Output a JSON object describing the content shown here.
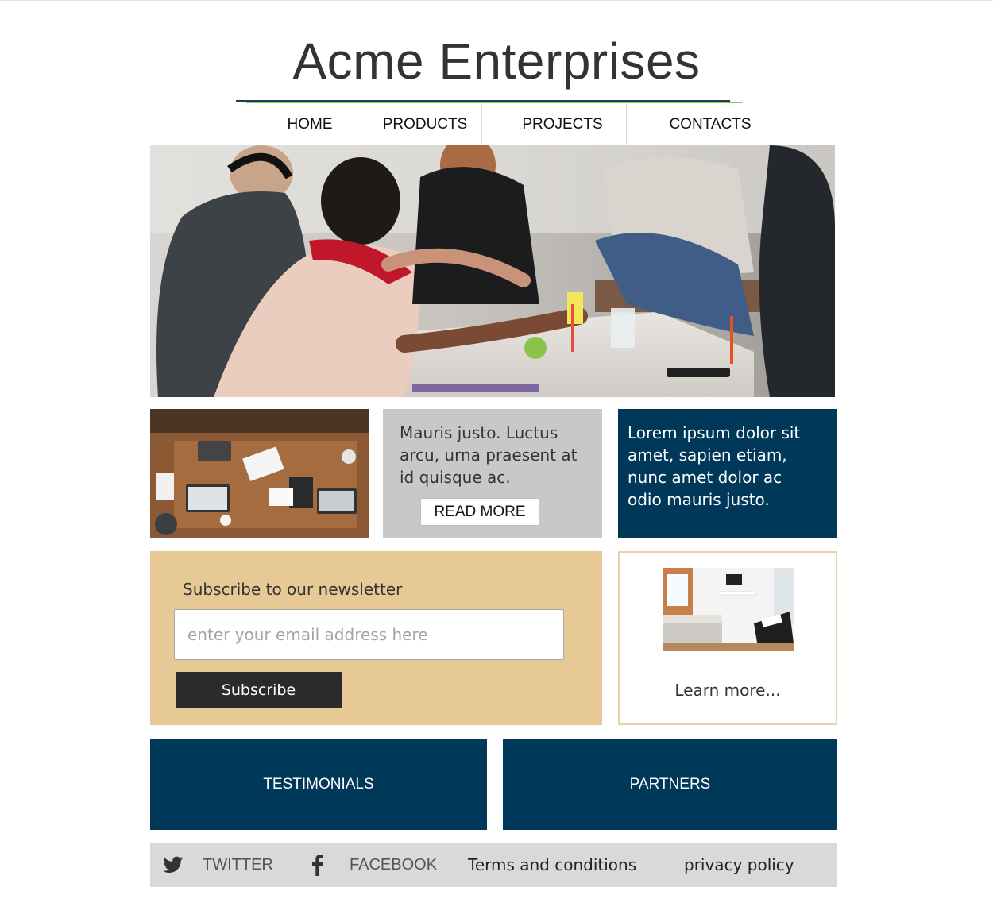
{
  "site": {
    "title": "Acme Enterprises"
  },
  "nav": {
    "items": [
      "HOME",
      "PRODUCTS",
      "PROJECTS",
      "CONTACTS"
    ]
  },
  "tiles": {
    "gray_text": "Mauris justo. Luctus arcu, urna praesent at id quisque ac.",
    "read_more": "READ MORE",
    "navy_text": "Lorem ipsum dolor sit amet, sapien etiam, nunc amet dolor ac odio mauris justo."
  },
  "newsletter": {
    "title": "Subscribe to our newsletter",
    "placeholder": "enter your email address here",
    "button": "Subscribe"
  },
  "learn_more": {
    "label": "Learn more..."
  },
  "boxes": {
    "testimonials": "TESTIMONIALS",
    "partners": "PARTNERS"
  },
  "footer": {
    "twitter": "TWITTER",
    "facebook": "FACEBOOK",
    "terms": "Terms and conditions",
    "privacy": "privacy policy"
  },
  "colors": {
    "navy": "#003859",
    "tan": "#e6c994",
    "gray": "#c8c8c8",
    "dark_button": "#2b2b2b",
    "footer": "#d9d9d9"
  },
  "icons": {
    "twitter": "twitter-icon",
    "facebook": "facebook-icon"
  }
}
